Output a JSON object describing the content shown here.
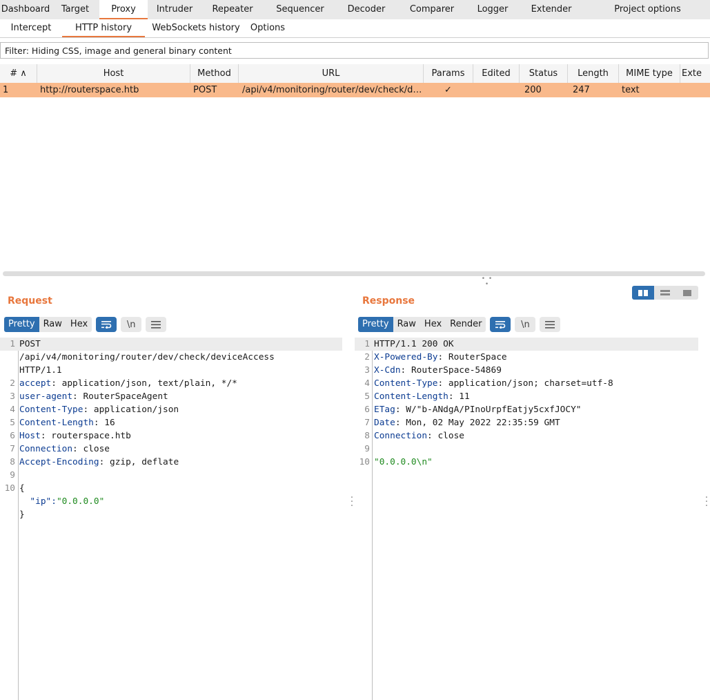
{
  "top_tabs": [
    {
      "label": "Dashboard",
      "active": false
    },
    {
      "label": "Target",
      "active": false
    },
    {
      "label": "Proxy",
      "active": true
    },
    {
      "label": "Intruder",
      "active": false
    },
    {
      "label": "Repeater",
      "active": false
    },
    {
      "label": "Sequencer",
      "active": false
    },
    {
      "label": "Decoder",
      "active": false
    },
    {
      "label": "Comparer",
      "active": false
    },
    {
      "label": "Logger",
      "active": false
    },
    {
      "label": "Extender",
      "active": false
    },
    {
      "label": "Project options",
      "active": false
    }
  ],
  "sub_tabs": [
    {
      "label": "Intercept",
      "active": false
    },
    {
      "label": "HTTP history",
      "active": true
    },
    {
      "label": "WebSockets history",
      "active": false
    },
    {
      "label": "Options",
      "active": false
    }
  ],
  "filter": {
    "text": "Filter: Hiding CSS, image and general binary content"
  },
  "table": {
    "columns": [
      "# ∧",
      "Host",
      "Method",
      "URL",
      "Params",
      "Edited",
      "Status",
      "Length",
      "MIME type",
      "Exte"
    ],
    "rows": [
      {
        "num": "1",
        "host": "http://routerspace.htb",
        "method": "POST",
        "url": "/api/v4/monitoring/router/dev/check/de...",
        "params": "✓",
        "edited": "",
        "status": "200",
        "length": "247",
        "mime": "text",
        "ext": ""
      }
    ],
    "selected_row_color": "#f9b98b"
  },
  "request": {
    "title": "Request",
    "tabs": [
      "Pretty",
      "Raw",
      "Hex"
    ],
    "active_tab": "Pretty",
    "icons": [
      "wrap-lines-icon",
      "newline-icon",
      "menu-icon"
    ],
    "newline_label": "\\n",
    "lines": [
      {
        "n": "1",
        "parts": [
          {
            "t": "POST",
            "c": "txt"
          }
        ]
      },
      {
        "n": "",
        "parts": [
          {
            "t": "/api/v4/monitoring/router/dev/check/deviceAccess",
            "c": "txt"
          }
        ]
      },
      {
        "n": "",
        "parts": [
          {
            "t": "HTTP/1.1",
            "c": "txt"
          }
        ]
      },
      {
        "n": "2",
        "parts": [
          {
            "t": "accept",
            "c": "key"
          },
          {
            "t": ": application/json, text/plain, */*",
            "c": "txt"
          }
        ]
      },
      {
        "n": "3",
        "parts": [
          {
            "t": "user-agent",
            "c": "key"
          },
          {
            "t": ": RouterSpaceAgent",
            "c": "txt"
          }
        ]
      },
      {
        "n": "4",
        "parts": [
          {
            "t": "Content-Type",
            "c": "key"
          },
          {
            "t": ": application/json",
            "c": "txt"
          }
        ]
      },
      {
        "n": "5",
        "parts": [
          {
            "t": "Content-Length",
            "c": "key"
          },
          {
            "t": ": 16",
            "c": "txt"
          }
        ]
      },
      {
        "n": "6",
        "parts": [
          {
            "t": "Host",
            "c": "key"
          },
          {
            "t": ": routerspace.htb",
            "c": "txt"
          }
        ]
      },
      {
        "n": "7",
        "parts": [
          {
            "t": "Connection",
            "c": "key"
          },
          {
            "t": ": close",
            "c": "txt"
          }
        ]
      },
      {
        "n": "8",
        "parts": [
          {
            "t": "Accept-Encoding",
            "c": "key"
          },
          {
            "t": ": gzip, deflate",
            "c": "txt"
          }
        ]
      },
      {
        "n": "9",
        "parts": []
      },
      {
        "n": "10",
        "parts": [
          {
            "t": "{",
            "c": "txt"
          }
        ]
      },
      {
        "n": "",
        "parts": [
          {
            "t": "  \"ip\":",
            "c": "key"
          },
          {
            "t": "\"0.0.0.0\"",
            "c": "str"
          }
        ]
      },
      {
        "n": "",
        "parts": [
          {
            "t": "}",
            "c": "txt"
          }
        ]
      }
    ]
  },
  "response": {
    "title": "Response",
    "tabs": [
      "Pretty",
      "Raw",
      "Hex",
      "Render"
    ],
    "active_tab": "Pretty",
    "icons": [
      "wrap-lines-icon",
      "newline-icon",
      "menu-icon"
    ],
    "newline_label": "\\n",
    "lines": [
      {
        "n": "1",
        "parts": [
          {
            "t": "HTTP/1.1 200 OK",
            "c": "txt"
          }
        ]
      },
      {
        "n": "2",
        "parts": [
          {
            "t": "X-Powered-By",
            "c": "key"
          },
          {
            "t": ": RouterSpace",
            "c": "txt"
          }
        ]
      },
      {
        "n": "3",
        "parts": [
          {
            "t": "X-Cdn",
            "c": "key"
          },
          {
            "t": ": RouterSpace-54869",
            "c": "txt"
          }
        ]
      },
      {
        "n": "4",
        "parts": [
          {
            "t": "Content-Type",
            "c": "key"
          },
          {
            "t": ": application/json; charset=utf-8",
            "c": "txt"
          }
        ]
      },
      {
        "n": "5",
        "parts": [
          {
            "t": "Content-Length",
            "c": "key"
          },
          {
            "t": ": 11",
            "c": "txt"
          }
        ]
      },
      {
        "n": "6",
        "parts": [
          {
            "t": "ETag",
            "c": "key"
          },
          {
            "t": ": W/\"b-ANdgA/PInoUrpfEatjy5cxfJOCY\"",
            "c": "txt"
          }
        ]
      },
      {
        "n": "7",
        "parts": [
          {
            "t": "Date",
            "c": "key"
          },
          {
            "t": ": Mon, 02 May 2022 22:35:59 GMT",
            "c": "txt"
          }
        ]
      },
      {
        "n": "8",
        "parts": [
          {
            "t": "Connection",
            "c": "key"
          },
          {
            "t": ": close",
            "c": "txt"
          }
        ]
      },
      {
        "n": "9",
        "parts": []
      },
      {
        "n": "10",
        "parts": [
          {
            "t": "\"0.0.0.0\\n\"",
            "c": "str"
          }
        ]
      }
    ]
  },
  "colors": {
    "accent": "#e8773d",
    "active_button": "#2e6fb0",
    "header_key": "#0b3b91",
    "string": "#1f8a1f"
  }
}
